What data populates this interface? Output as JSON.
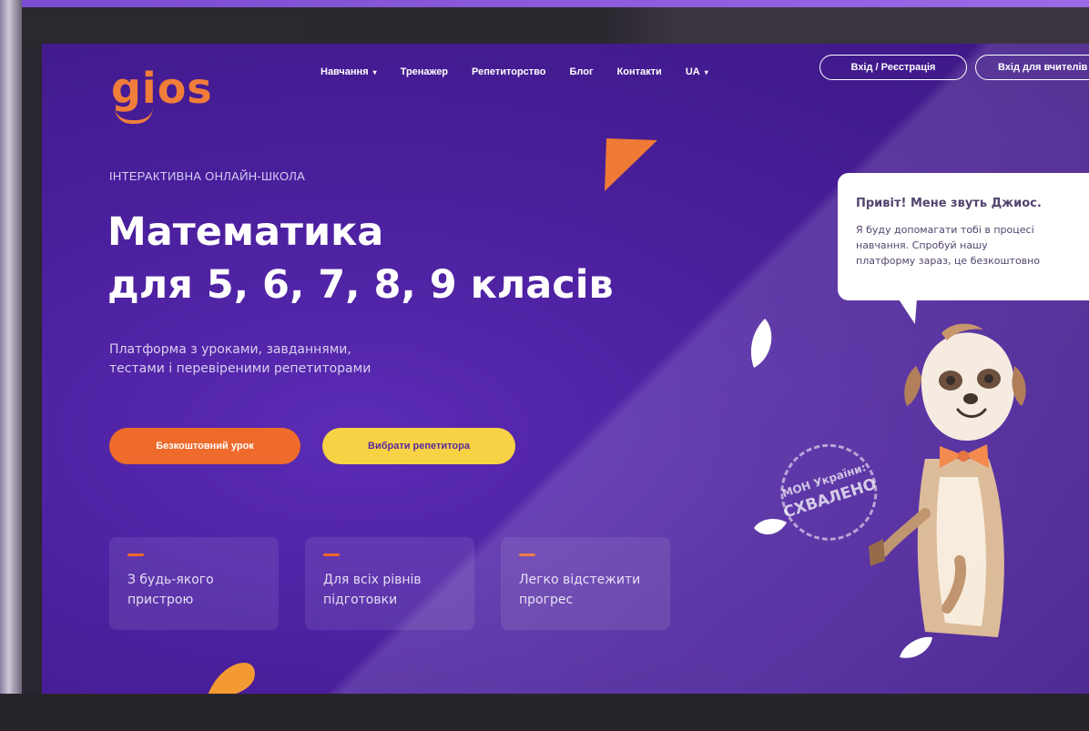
{
  "logo": {
    "text": "gios"
  },
  "nav": {
    "items": [
      {
        "label": "Навчання",
        "has_dropdown": true
      },
      {
        "label": "Тренажер"
      },
      {
        "label": "Репетиторство"
      },
      {
        "label": "Блог"
      },
      {
        "label": "Контакти"
      },
      {
        "label": "UA",
        "has_dropdown": true
      }
    ],
    "login_button": "Вхід / Реєстрація",
    "teacher_login_button": "Вхід для вчителів"
  },
  "hero": {
    "eyebrow": "ІНТЕРАКТИВНА ОНЛАЙН-ШКОЛА",
    "title_line1": "Математика",
    "title_line2": "для 5, 6, 7, 8, 9 класів",
    "subtitle_line1": "Платформа з уроками, завданнями,",
    "subtitle_line2": "тестами і перевіреними репетиторами",
    "cta_primary": "Безкоштовний урок",
    "cta_secondary": "Вибрати репетитора"
  },
  "features": [
    {
      "line1": "З будь-якого",
      "line2": "пристрою"
    },
    {
      "line1": "Для всіх рівнів",
      "line2": "підготовки"
    },
    {
      "line1": "Легко відстежити",
      "line2": "прогрес"
    }
  ],
  "mascot_bubble": {
    "title": "Привіт! Мене звуть Джиос.",
    "line1": "Я буду допомагати тобі в процесі",
    "line2": "навчання. Спробуй нашу",
    "line3": "платформу зараз, це безкоштовно"
  },
  "stamp": {
    "line1": "МОН України:",
    "line2": "СХВАЛЕНО"
  },
  "colors": {
    "background": "#4a1f9c",
    "accent_orange": "#ee6b2b",
    "accent_yellow": "#f7d245",
    "logo": "#f07d3a"
  },
  "icons": {
    "nav_dropdown": "chevron-down-icon",
    "mascot": "meerkat-mascot-illustration"
  }
}
